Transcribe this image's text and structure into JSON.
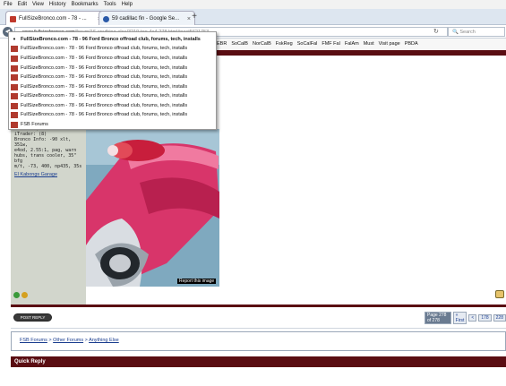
{
  "menubar": [
    "File",
    "Edit",
    "View",
    "History",
    "Bookmarks",
    "Tools",
    "Help"
  ],
  "tabs": [
    {
      "title": "FullSizeBronco.com - 78 - ...",
      "active": true
    },
    {
      "title": "59 cadillac fin - Google Se...",
      "active": false
    }
  ],
  "newtab_label": "+",
  "url": {
    "host": "www.fullsizebronco.com",
    "path": "/forum/16-anything-else/3219-too-4x4-278.html#post5621753"
  },
  "search_placeholder": "Search",
  "bookmarks": [
    "EBR",
    "SoCalB",
    "NorCalB",
    "FskReg",
    "SoCalFal",
    "FMF Fal",
    "FalAm",
    "Must",
    "Visit page",
    "PBDA"
  ],
  "dropdown": {
    "items": [
      {
        "label": "FullSizeBronco.com - 78 - 96 Ford Bronco offroad club, forums, tech, installs",
        "current": true
      },
      {
        "label": "FullSizeBronco.com - 78 - 96 Ford Bronco offroad club, forums, tech, installs",
        "current": false
      },
      {
        "label": "FullSizeBronco.com - 78 - 96 Ford Bronco offroad club, forums, tech, installs",
        "current": false
      },
      {
        "label": "FullSizeBronco.com - 78 - 96 Ford Bronco offroad club, forums, tech, installs",
        "current": false
      },
      {
        "label": "FullSizeBronco.com - 78 - 96 Ford Bronco offroad club, forums, tech, installs",
        "current": false
      },
      {
        "label": "FullSizeBronco.com - 78 - 96 Ford Bronco offroad club, forums, tech, installs",
        "current": false
      },
      {
        "label": "FullSizeBronco.com - 78 - 96 Ford Bronco offroad club, forums, tech, installs",
        "current": false
      },
      {
        "label": "FullSizeBronco.com - 78 - 96 Ford Bronco offroad club, forums, tech, installs",
        "current": false
      },
      {
        "label": "FullSizeBronco.com - 78 - 96 Ford Bronco offroad club, forums, tech, installs",
        "current": false
      },
      {
        "label": "FSB Forums",
        "current": false
      }
    ]
  },
  "user": {
    "lines": [
      "Posts: 5,801",
      "iTrader: (8)",
      "Bronco Info: -90 xlt, 351w,",
      "e4od, 2.55:1, pag, warn",
      "hubs, trans cooler, 35\" bfg",
      "m/t, -73, 400, np435, 35s"
    ],
    "garage": "El Kabongs Garage"
  },
  "report_image": "Report this image",
  "post_reply": "POST REPLY",
  "pagination": {
    "label": "Page 278 of 278",
    "first": "« First",
    "prev": "<",
    "p1": "178",
    "p2": "228"
  },
  "breadcrumb": {
    "b1": "FSB Forums",
    "sep": ">",
    "b2": "Other Forums",
    "b3": "Anything Else"
  },
  "quick_reply": "Quick Reply",
  "colors": {
    "site_maroon": "#5a0d12",
    "link": "#1a3d8f",
    "sidebar": "#d2d6cc"
  }
}
